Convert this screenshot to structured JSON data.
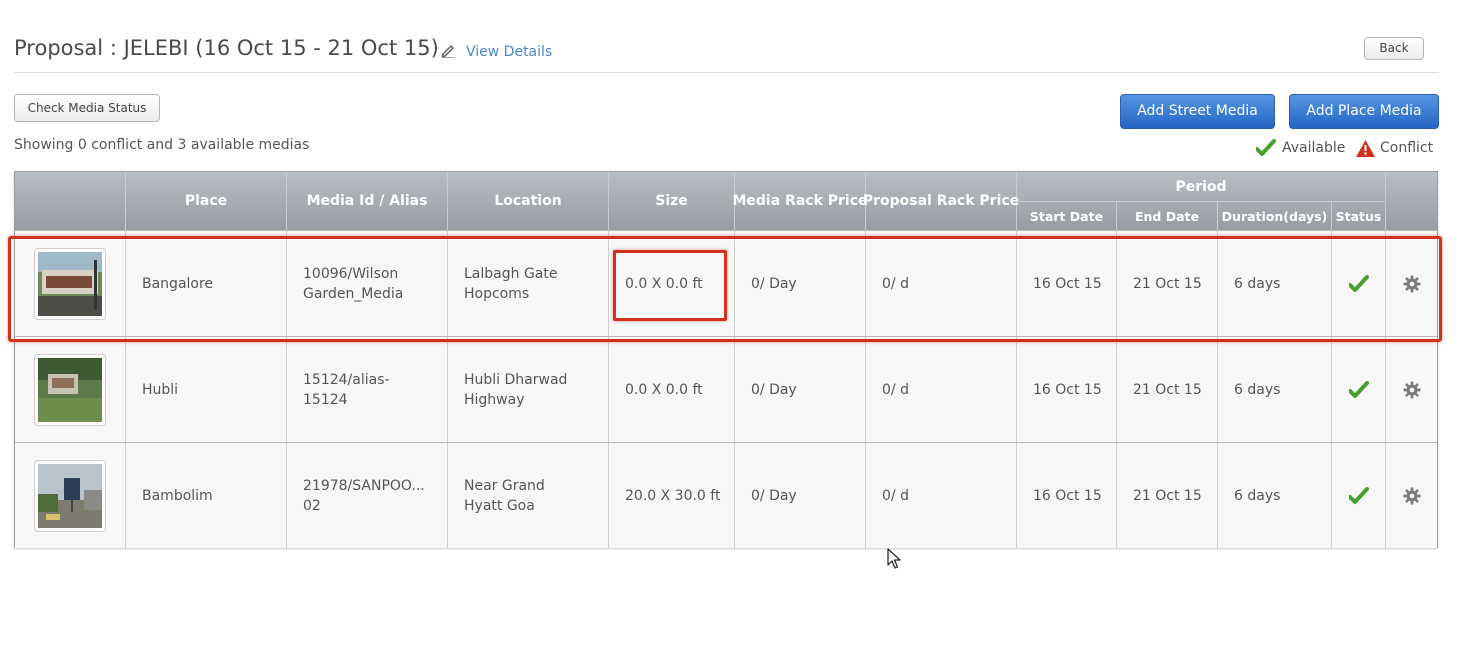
{
  "header": {
    "title": "Proposal : JELEBI (16 Oct 15 - 21 Oct 15)",
    "view_details": "View Details",
    "back_label": "Back"
  },
  "toolbar": {
    "check_status_label": "Check Media Status",
    "add_street_label": "Add Street Media",
    "add_place_label": "Add Place Media"
  },
  "summary": "Showing 0 conflict and 3 available medias",
  "legend": {
    "available": "Available",
    "conflict": "Conflict"
  },
  "table": {
    "columns": {
      "place": "Place",
      "media": "Media Id / Alias",
      "location": "Location",
      "size": "Size",
      "media_rack": "Media Rack Price",
      "proposal_rack": "Proposal Rack Price",
      "period": "Period",
      "start": "Start Date",
      "end": "End Date",
      "duration": "Duration(days)",
      "status": "Status"
    },
    "rows": [
      {
        "place": "Bangalore",
        "media_line1": "10096/Wilson",
        "media_line2": "Garden_Media",
        "location_line1": "Lalbagh Gate",
        "location_line2": "Hopcoms",
        "size": "0.0 X 0.0 ft",
        "media_rack": "0/ Day",
        "proposal_rack": "0/ d",
        "start": "16 Oct 15",
        "end": "21 Oct 15",
        "duration": "6 days",
        "status": "available"
      },
      {
        "place": "Hubli",
        "media_line1": "15124/alias-",
        "media_line2": "15124",
        "location_line1": "Hubli Dharwad",
        "location_line2": "Highway",
        "size": "0.0 X 0.0 ft",
        "media_rack": "0/ Day",
        "proposal_rack": "0/ d",
        "start": "16 Oct 15",
        "end": "21 Oct 15",
        "duration": "6 days",
        "status": "available"
      },
      {
        "place": "Bambolim",
        "media_line1": "21978/SANPOO...",
        "media_line2": "02",
        "location_line1": "Near Grand",
        "location_line2": "Hyatt Goa",
        "size": "20.0 X 30.0 ft",
        "media_rack": "0/ Day",
        "proposal_rack": "0/ d",
        "start": "16 Oct 15",
        "end": "21 Oct 15",
        "duration": "6 days",
        "status": "available"
      }
    ]
  },
  "colors": {
    "accent_blue": "#2466c4",
    "link": "#4a86c5",
    "available_green": "#4aa02c",
    "conflict_red": "#d0321c",
    "highlight": "#d0321c"
  },
  "icons": {
    "edit": "pencil-icon",
    "available": "checkmark-icon",
    "conflict": "warning-triangle-icon",
    "settings": "gear-icon"
  }
}
